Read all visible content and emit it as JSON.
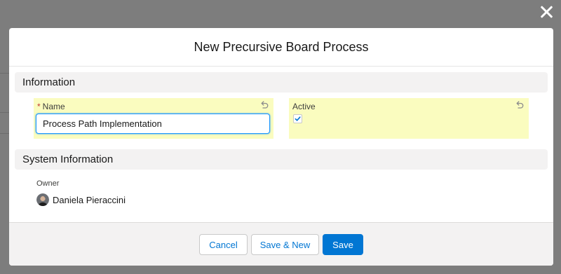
{
  "modal": {
    "title": "New Precursive Board Process"
  },
  "sections": {
    "information": "Information",
    "system_information": "System Information"
  },
  "fields": {
    "name": {
      "required_marker": "*",
      "label": "Name",
      "value": "Process Path Implementation"
    },
    "active": {
      "label": "Active",
      "checked": true
    },
    "owner": {
      "label": "Owner",
      "value": "Daniela Pieraccini"
    }
  },
  "footer": {
    "cancel_label": "Cancel",
    "save_new_label": "Save & New",
    "save_label": "Save"
  },
  "icons": {
    "close": "close-icon",
    "undo": "undo-icon",
    "check": "check-icon"
  },
  "colors": {
    "brand": "#0176d3",
    "field_highlight": "#fafcbf",
    "section_bar": "#f3f2f2",
    "required": "#c23934"
  }
}
